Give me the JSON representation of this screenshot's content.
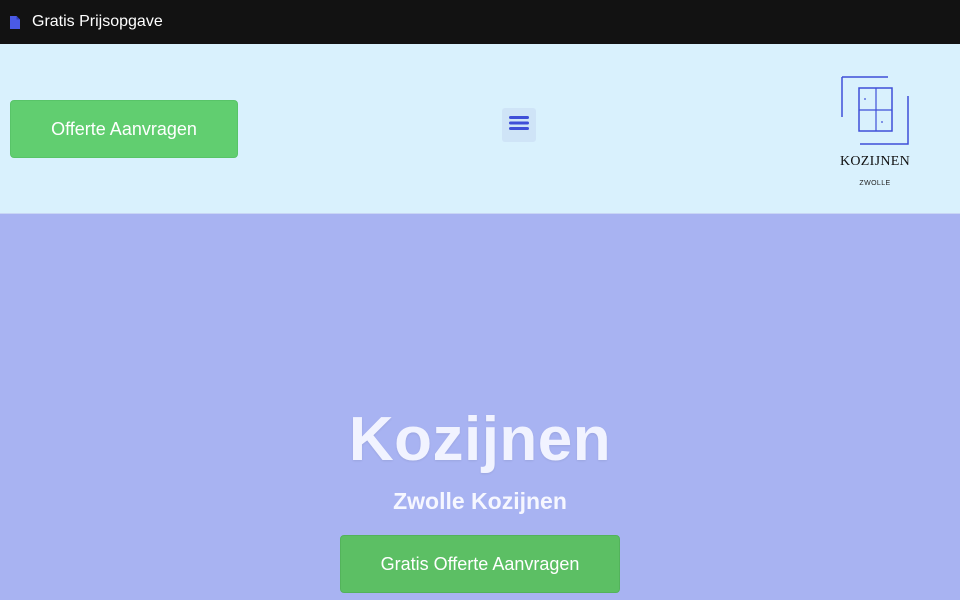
{
  "window": {
    "title": "Gratis Prijsopgave",
    "icon": "document-icon"
  },
  "header": {
    "cta_label": "Offerte Aanvragen",
    "menu_icon": "hamburger-menu-icon",
    "logo": {
      "brand": "KOZIJNEN",
      "subtitle": "ZWOLLE"
    }
  },
  "hero": {
    "title": "Kozijnen",
    "subtitle": "Zwolle Kozijnen",
    "cta_label": "Gratis Offerte Aanvragen"
  },
  "colors": {
    "header_bg": "#d9f1fd",
    "hero_bg": "#a8b3f2",
    "cta_green": "#61ce70",
    "accent_blue": "#3f4fd8"
  }
}
